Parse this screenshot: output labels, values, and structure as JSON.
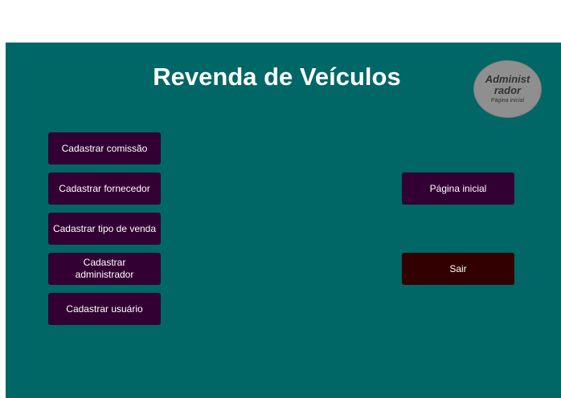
{
  "header": {
    "title": "Revenda de Veículos"
  },
  "user_badge": {
    "role": "Administrador",
    "link": "Página inicial"
  },
  "menu": {
    "items": [
      {
        "label": "Cadastrar comissão"
      },
      {
        "label": "Cadastrar fornecedor"
      },
      {
        "label": "Cadastrar tipo de venda"
      },
      {
        "label": "Cadastrar administrador"
      },
      {
        "label": "Cadastrar usuário"
      }
    ]
  },
  "actions": {
    "home_label": "Página inicial",
    "exit_label": "Sair"
  },
  "colors": {
    "panel": "#006666",
    "button": "#330033",
    "exit_button": "#330000",
    "badge": "#8f8f8f"
  }
}
